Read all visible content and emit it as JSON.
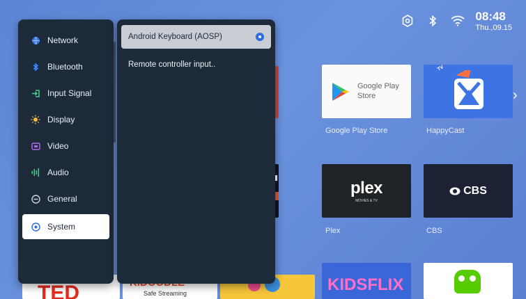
{
  "status": {
    "time": "08:48",
    "date": "Thu.,09.15"
  },
  "apps": {
    "google_play_store": {
      "logo_text": "Google Play Store",
      "label": "Google Play Store"
    },
    "happycast": {
      "label": "HappyCast",
      "badge": "TV"
    },
    "plex": {
      "logo_text": "plex",
      "logo_sub": "MOVIES & TV",
      "label": "Plex"
    },
    "cbs": {
      "logo_text": "CBS",
      "label": "CBS"
    },
    "ted": {
      "logo_text": "TED"
    },
    "kidoodle": {
      "logo_text": "KIDOODLE",
      "sub": "Safe Streaming"
    },
    "kidsflix": {
      "logo_text": "KIDSFLIX"
    }
  },
  "settings_menu": {
    "items": [
      {
        "label": "Network",
        "icon": "globe-icon"
      },
      {
        "label": "Bluetooth",
        "icon": "bluetooth-icon"
      },
      {
        "label": "Input Signal",
        "icon": "input-icon"
      },
      {
        "label": "Display",
        "icon": "sun-icon"
      },
      {
        "label": "Video",
        "icon": "video-icon"
      },
      {
        "label": "Audio",
        "icon": "audio-bars-icon"
      },
      {
        "label": "General",
        "icon": "general-icon"
      },
      {
        "label": "System",
        "icon": "system-icon"
      }
    ],
    "selected": "System"
  },
  "sub_menu": {
    "items": [
      {
        "label": "Android Keyboard (AOSP)",
        "selected": true
      },
      {
        "label": "Remote controller input..",
        "selected": false
      }
    ]
  },
  "colors": {
    "panel_bg": "#1d2a3a",
    "launcher_bg": "#5b86d6",
    "accent": "#2a6de0"
  }
}
